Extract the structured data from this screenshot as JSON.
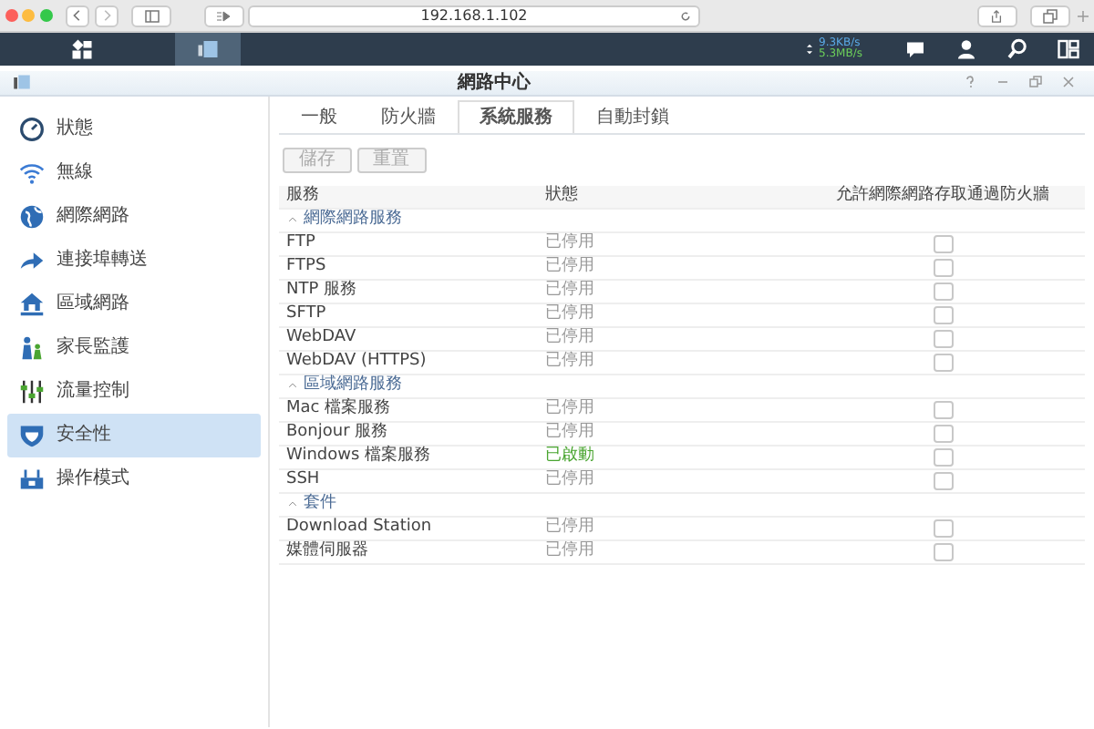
{
  "browser": {
    "address": "192.168.1.102"
  },
  "taskbar": {
    "upload_speed": "9.3KB/s",
    "download_speed": "5.3MB/s"
  },
  "window": {
    "title": "網路中心"
  },
  "sidebar": {
    "items": [
      {
        "label": "狀態",
        "selected": false
      },
      {
        "label": "無線",
        "selected": false
      },
      {
        "label": "網際網路",
        "selected": false
      },
      {
        "label": "連接埠轉送",
        "selected": false
      },
      {
        "label": "區域網路",
        "selected": false
      },
      {
        "label": "家長監護",
        "selected": false
      },
      {
        "label": "流量控制",
        "selected": false
      },
      {
        "label": "安全性",
        "selected": true
      },
      {
        "label": "操作模式",
        "selected": false
      }
    ]
  },
  "tabs": [
    {
      "label": "一般",
      "selected": false
    },
    {
      "label": "防火牆",
      "selected": false
    },
    {
      "label": "系統服務",
      "selected": true
    },
    {
      "label": "自動封鎖",
      "selected": false
    }
  ],
  "buttons": [
    {
      "label": "儲存",
      "disabled": true
    },
    {
      "label": "重置",
      "disabled": true
    }
  ],
  "table": {
    "columns": [
      "服務",
      "狀態",
      "允許網際網路存取通過防火牆"
    ],
    "groups": [
      {
        "title": "網際網路服務",
        "expanded": true,
        "rows": [
          {
            "service": "FTP",
            "status": "已停用",
            "running": false,
            "allowed": false
          },
          {
            "service": "FTPS",
            "status": "已停用",
            "running": false,
            "allowed": false
          },
          {
            "service": "NTP 服務",
            "status": "已停用",
            "running": false,
            "allowed": false
          },
          {
            "service": "SFTP",
            "status": "已停用",
            "running": false,
            "allowed": false
          },
          {
            "service": "WebDAV",
            "status": "已停用",
            "running": false,
            "allowed": false
          },
          {
            "service": "WebDAV (HTTPS)",
            "status": "已停用",
            "running": false,
            "allowed": false
          }
        ]
      },
      {
        "title": "區域網路服務",
        "expanded": true,
        "rows": [
          {
            "service": "Mac 檔案服務",
            "status": "已停用",
            "running": false,
            "allowed": false
          },
          {
            "service": "Bonjour 服務",
            "status": "已停用",
            "running": false,
            "allowed": false
          },
          {
            "service": "Windows 檔案服務",
            "status": "已啟動",
            "running": true,
            "allowed": false
          },
          {
            "service": "SSH",
            "status": "已停用",
            "running": false,
            "allowed": false
          }
        ]
      },
      {
        "title": "套件",
        "expanded": true,
        "rows": [
          {
            "service": "Download Station",
            "status": "已停用",
            "running": false,
            "allowed": false
          },
          {
            "service": "媒體伺服器",
            "status": "已停用",
            "running": false,
            "allowed": false
          }
        ]
      }
    ]
  }
}
